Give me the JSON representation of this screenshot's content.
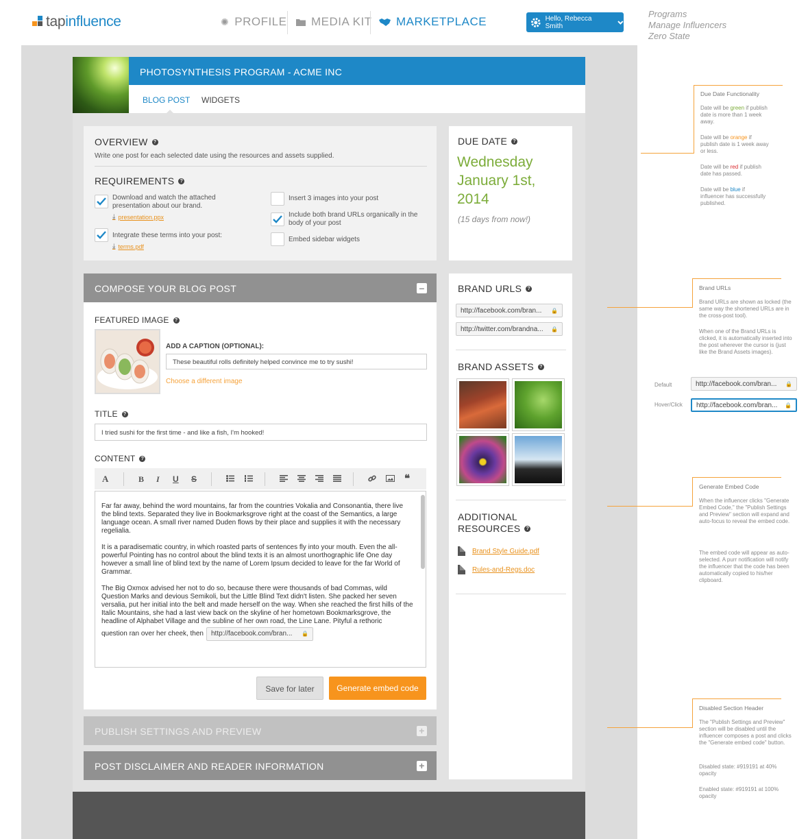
{
  "header": {
    "logo_tap": "tap",
    "logo_influence": "influence",
    "nav": [
      {
        "label": "PROFILE",
        "icon": "spinner-icon"
      },
      {
        "label": "MEDIA KIT",
        "icon": "folder-icon"
      },
      {
        "label": "MARKETPLACE",
        "icon": "handshake-icon"
      }
    ],
    "user_greeting": "Hello, Rebecca Smith"
  },
  "breadcrumbs": [
    "Programs",
    "Manage Influencers",
    "Zero State"
  ],
  "program": {
    "title": "PHOTOSYNTHESIS PROGRAM - ACME INC",
    "tabs": [
      "BLOG POST",
      "WIDGETS"
    ]
  },
  "overview": {
    "heading": "OVERVIEW",
    "text": "Write one post for each selected date using the resources and assets supplied."
  },
  "requirements": {
    "heading": "REQUIREMENTS",
    "items": [
      {
        "text": "Download and watch the attached presentation about our brand.",
        "checked": true,
        "file": "presentation.ppx"
      },
      {
        "text": "Integrate these terms into your post:",
        "checked": true,
        "file": "terms.pdf"
      },
      {
        "text": "Insert 3 images into your post",
        "checked": false
      },
      {
        "text": "Include both brand URLs organically in the body of your post",
        "checked": true
      },
      {
        "text": "Embed sidebar widgets",
        "checked": false
      }
    ]
  },
  "due_date": {
    "heading": "DUE DATE",
    "line1": "Wednesday",
    "line2": "January 1st,",
    "line3": "2014",
    "relative": "(15 days from now!)",
    "color": "#7cac3a"
  },
  "compose": {
    "heading": "COMPOSE YOUR BLOG POST",
    "featured_image_label": "FEATURED IMAGE",
    "caption_label": "ADD A CAPTION (OPTIONAL):",
    "caption_value": "These beautiful rolls definitely helped convince me to try sushi!",
    "change_image": "Choose a different image",
    "title_label": "TITLE",
    "title_value": "I tried sushi for the first time - and like a fish, I'm hooked!",
    "content_label": "CONTENT",
    "toolbar": [
      "A",
      "B",
      "I",
      "U",
      "S"
    ],
    "paragraphs": [
      "Far far away, behind the word mountains, far from the countries Vokalia and Consonantia, there live the blind texts. Separated they live in Bookmarksgrove right at the coast of the Semantics, a large language ocean. A small river named Duden flows by their place and supplies it with the necessary regelialia.",
      "It is a paradisematic country, in which roasted parts of sentences fly into your mouth. Even the all-powerful Pointing has no control about the blind texts it is an almost unorthographic life One day however a small line of blind text by the name of Lorem Ipsum decided to leave for the far World of Grammar.",
      "The Big Oxmox advised her not to do so, because there were thousands of bad Commas, wild Question Marks and devious Semikoli, but the Little Blind Text didn't listen. She packed her seven versalia, put her initial into the belt and made herself on the way. When she reached the first hills of the Italic Mountains, she had a last view back on the skyline of her hometown Bookmarksgrove, the headline of Alphabet Village and the subline of her own road, the Line Lane. Pityful a rethoric"
    ],
    "last_line": "question ran over her cheek, then",
    "inline_url": "http://facebook.com/bran...",
    "save_label": "Save for later",
    "generate_label": "Generate embed code",
    "accent": "#f7941d"
  },
  "sections": [
    {
      "label": "PUBLISH SETTINGS AND PREVIEW",
      "disabled": true
    },
    {
      "label": "POST DISCLAIMER AND READER INFORMATION",
      "disabled": false
    }
  ],
  "brand_urls": {
    "heading": "BRAND URLS",
    "urls": [
      "http://facebook.com/bran...",
      "http://twitter.com/brandna..."
    ]
  },
  "brand_assets": {
    "heading": "BRAND ASSETS",
    "items": [
      "autumn-trees-image",
      "grass-blade-image",
      "pansy-flower-image",
      "tree-silhouette-image"
    ]
  },
  "additional_resources": {
    "heading_line1": "ADDITIONAL",
    "heading_line2": "RESOURCES",
    "files": [
      "Brand Style Guide.pdf",
      "Rules-and-Regs.doc"
    ]
  },
  "annotations": {
    "due_date": {
      "title": "Due Date Functionality",
      "green": "Date will be green if publish date is more than 1 week away.",
      "orange": "Date will be orange if publish date is 1 week away or less.",
      "red": "Date will be red if publish date has passed.",
      "blue": "Date will be blue if influencer has successfully published."
    },
    "brand_urls": {
      "title": "Brand URLs",
      "p1": "Brand URLs are shown as locked (the same way the shortened URLs are in the cross-post tool).",
      "p2": "When one of the Brand URLs is clicked, it is automatically inserted into the post wherever the cursor is (just like the Brand Assets images).",
      "default_label": "Default",
      "hover_label": "Hover/Click",
      "sample_url": "http://facebook.com/bran..."
    },
    "embed": {
      "title": "Generate Embed Code",
      "p1": "When the influencer clicks \"Generate Embed Code,\" the \"Publish Settings and Preview\" section will expand and auto-focus to reveal the embed code.",
      "p2": "The embed code will appear as auto-selected. A purr notification will notify the influencer that the code has been automatically copied to his/her clipboard."
    },
    "disabled": {
      "title": "Disabled Section Header",
      "p1": "The \"Publish Settings and Preview\" section will be disabled until the influencer composes a post and clicks the \"Generate embed code\" button.",
      "p2": "Disabled state: #919191 at 40% opacity",
      "p3": "Enabled state: #919191 at 100% opacity"
    }
  },
  "colors": {
    "brand_blue": "#1e88c7",
    "orange": "#f7941d",
    "section_gray": "#919191",
    "green": "#7cac3a",
    "red": "#d9262b"
  }
}
